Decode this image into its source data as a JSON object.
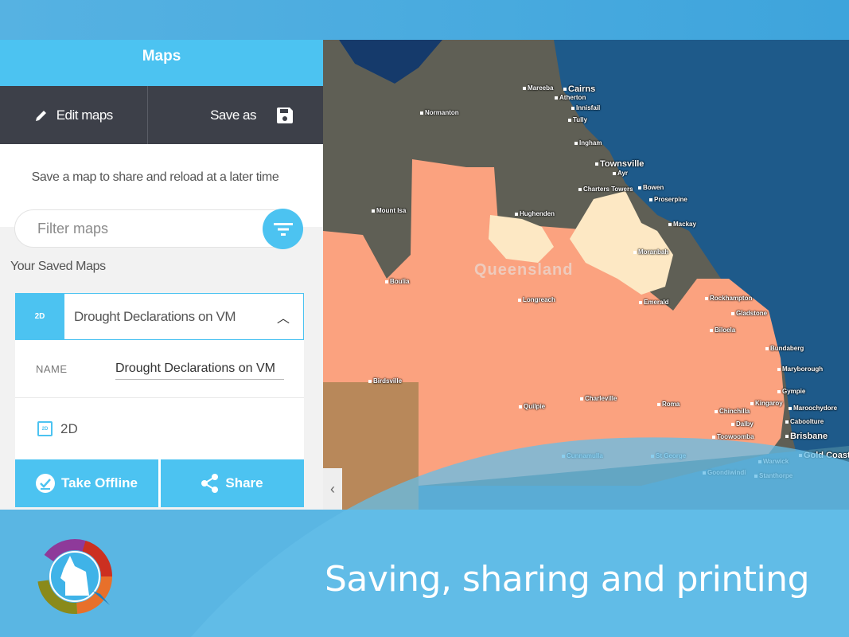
{
  "panel": {
    "title": "Maps",
    "edit_label": "Edit maps",
    "save_as_label": "Save as",
    "description": "Save a map to share and reload at a later time",
    "filter_placeholder": "Filter maps",
    "saved_heading": "Your Saved Maps",
    "card": {
      "icon_text": "2D",
      "title": "Drought Declarations on VM",
      "name_label": "NAME",
      "name_value": "Drought Declarations on VM",
      "dimension": "2D",
      "take_offline_label": "Take Offline",
      "share_label": "Share"
    }
  },
  "map": {
    "region_label": "Queensland",
    "towns": [
      "Mareeba",
      "Cairns",
      "Atherton",
      "Innisfail",
      "Tully",
      "Normanton",
      "Ingham",
      "Townsville",
      "Ayr",
      "Charters Towers",
      "Bowen",
      "Proserpine",
      "Mount Isa",
      "Hughenden",
      "Mackay",
      "Moranbah",
      "Boulia",
      "Longreach",
      "Emerald",
      "Rockhampton",
      "Gladstone",
      "Biloela",
      "Bundaberg",
      "Maryborough",
      "Gympie",
      "Birdsville",
      "Kingaroy",
      "Maroochydore",
      "Chinchilla",
      "Charleville",
      "Quilpie",
      "Roma",
      "Caboolture",
      "Dalby",
      "Toowoomba",
      "Brisbane",
      "Gold Coast",
      "Cunnamulla",
      "St George",
      "Warwick",
      "Goondiwindi",
      "Stanthorpe"
    ],
    "colors": {
      "drought": "#fba27f",
      "partial": "#fde8c4",
      "ocean": "#153a6b"
    }
  },
  "banner": {
    "title": "Saving, sharing and printing"
  },
  "colors": {
    "accent": "#4cc3f1",
    "toolbar": "#3d4049",
    "banner": "#5ab6e3"
  }
}
